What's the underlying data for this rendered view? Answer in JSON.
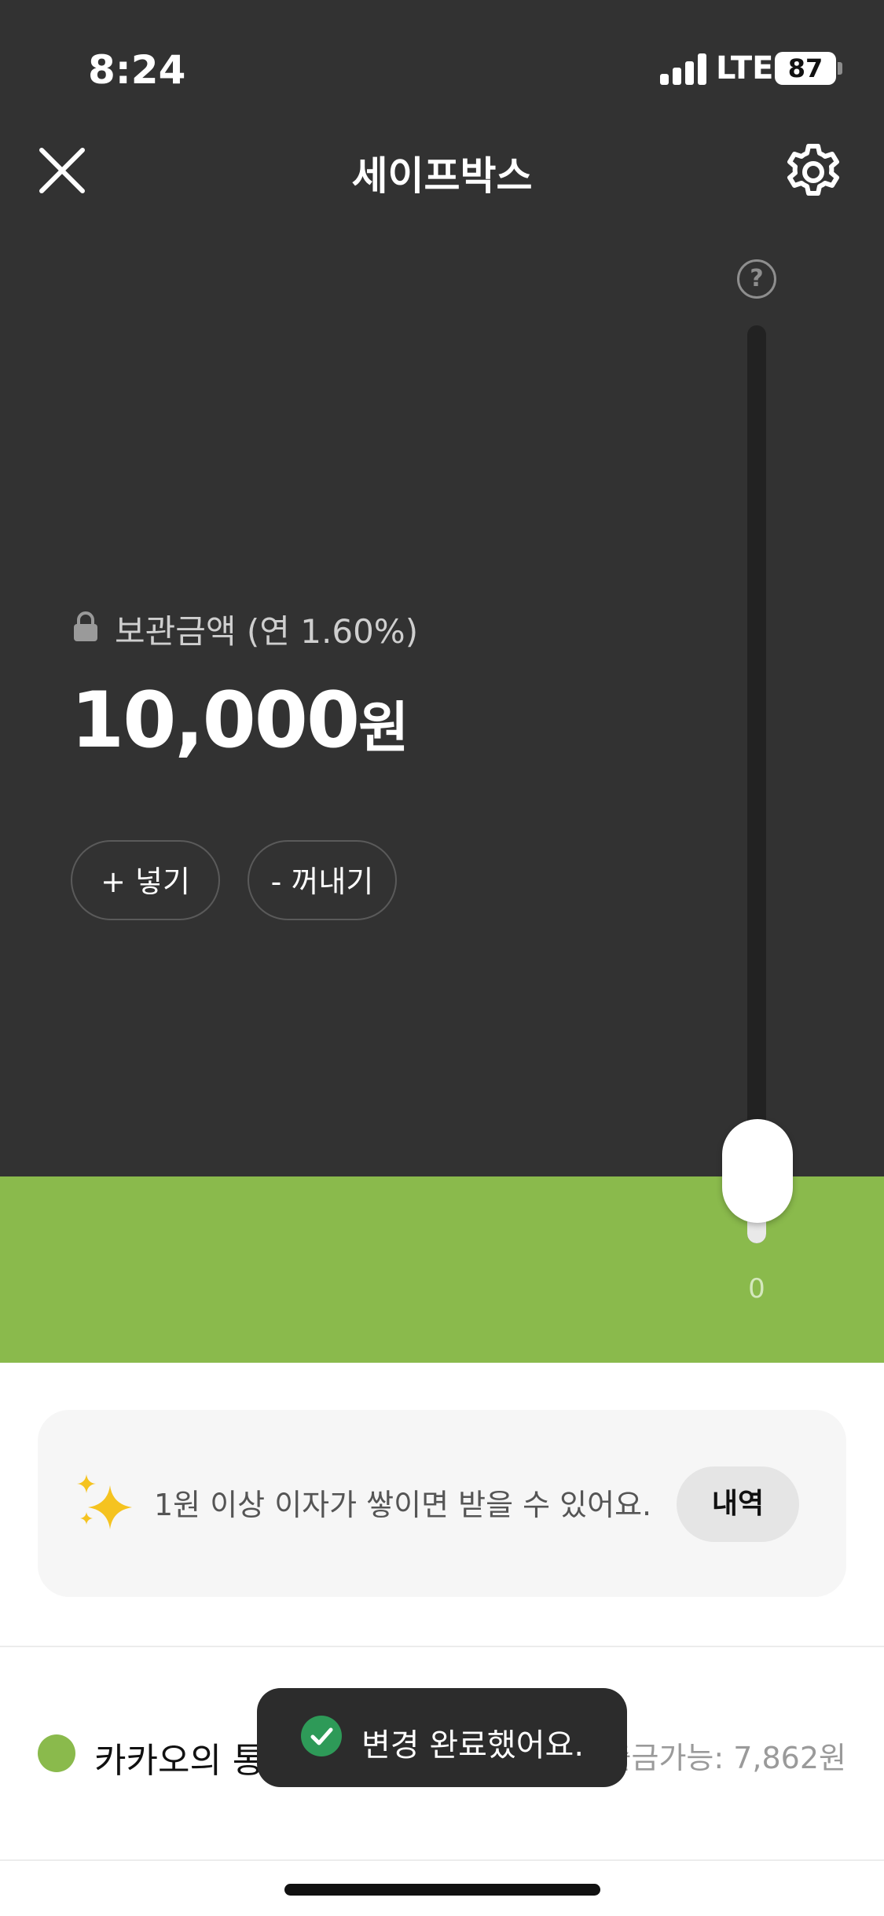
{
  "status_bar": {
    "time": "8:24",
    "network": "LTE",
    "battery": "87"
  },
  "header": {
    "title": "세이프박스",
    "close_icon": "close-icon",
    "settings_icon": "gear-icon"
  },
  "slider": {
    "help_label": "?",
    "value": "0",
    "fill_fraction": 0.0
  },
  "balance": {
    "label": "보관금액 (연 1.60%)",
    "amount": "10,000",
    "unit": "원"
  },
  "actions": {
    "deposit": "+ 넣기",
    "withdraw": "- 꺼내기"
  },
  "interest_card": {
    "message": "1원 이상 이자가 쌓이면 받을 수 있어요.",
    "history_button": "내역"
  },
  "account": {
    "name": "카카오의 통장",
    "available": "출금가능: 7,862원"
  },
  "toast": {
    "message": "변경 완료했어요."
  },
  "colors": {
    "dark_bg": "#323232",
    "accent_green": "#8aba4c",
    "toast_check": "#2e9a58"
  }
}
